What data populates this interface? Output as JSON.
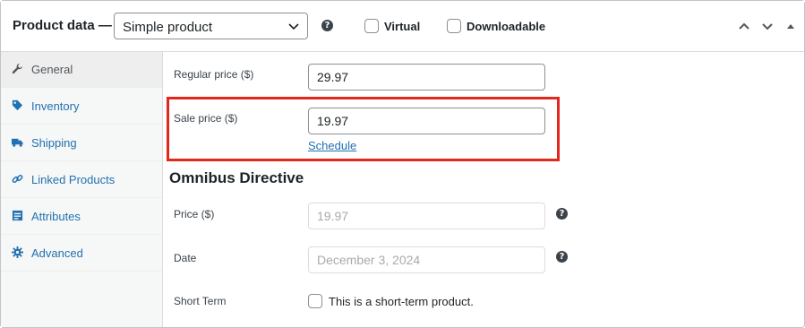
{
  "header": {
    "title": "Product data —",
    "product_type": "Simple product",
    "virtual_label": "Virtual",
    "downloadable_label": "Downloadable"
  },
  "sidebar": {
    "items": [
      {
        "label": "General",
        "icon": "wrench-icon",
        "active": true
      },
      {
        "label": "Inventory",
        "icon": "tag-icon",
        "active": false
      },
      {
        "label": "Shipping",
        "icon": "truck-icon",
        "active": false
      },
      {
        "label": "Linked Products",
        "icon": "link-icon",
        "active": false
      },
      {
        "label": "Attributes",
        "icon": "list-icon",
        "active": false
      },
      {
        "label": "Advanced",
        "icon": "gear-icon",
        "active": false
      }
    ]
  },
  "general": {
    "regular_price_label": "Regular price ($)",
    "regular_price_value": "29.97",
    "sale_price_label": "Sale price ($)",
    "sale_price_value": "19.97",
    "schedule_link": "Schedule"
  },
  "omnibus": {
    "title": "Omnibus Directive",
    "price_label": "Price ($)",
    "price_placeholder": "19.97",
    "date_label": "Date",
    "date_placeholder": "December 3, 2024",
    "short_term_label": "Short Term",
    "short_term_checkbox_label": "This is a short-term product."
  },
  "colors": {
    "accent": "#2271b1",
    "highlight": "#e4271b"
  }
}
